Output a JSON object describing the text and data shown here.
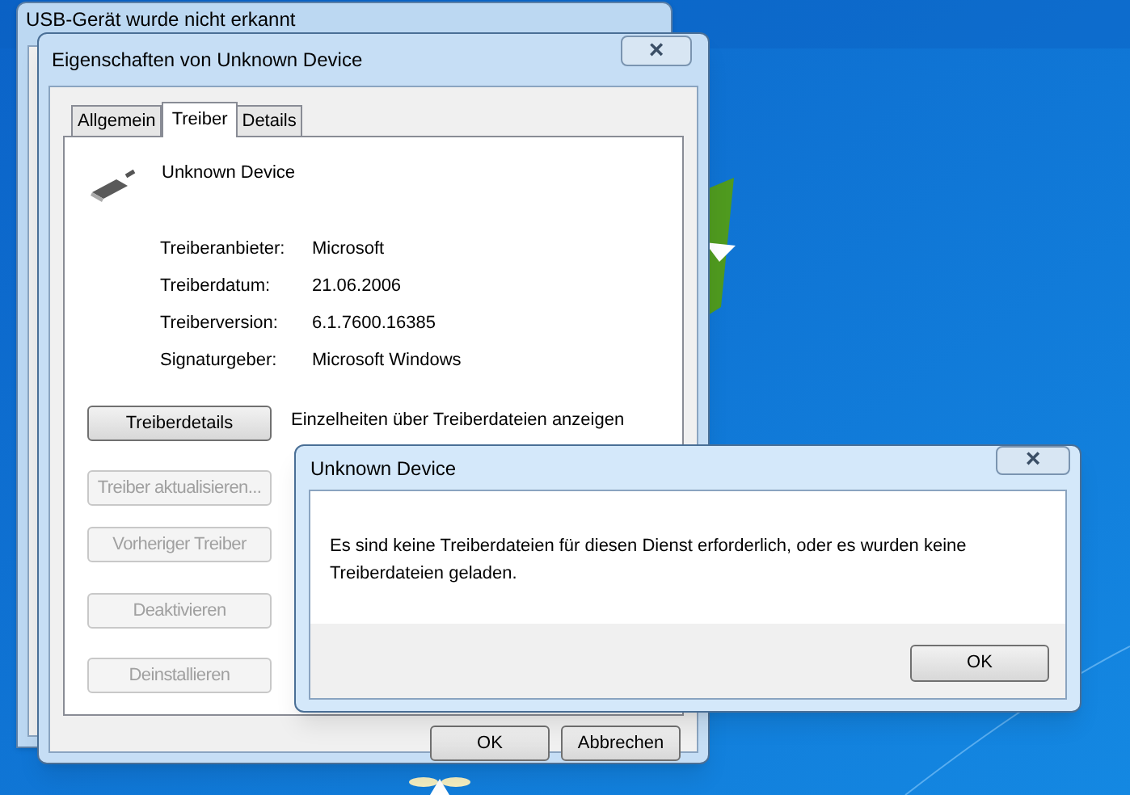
{
  "background_window": {
    "title": "USB-Gerät wurde nicht erkannt"
  },
  "properties_window": {
    "title": "Eigenschaften von Unknown Device",
    "close": "×",
    "tabs": [
      {
        "label": "Allgemein",
        "selected": false
      },
      {
        "label": "Treiber",
        "selected": true
      },
      {
        "label": "Details",
        "selected": false
      }
    ],
    "device_name": "Unknown Device",
    "fields": [
      {
        "label": "Treiberanbieter:",
        "value": "Microsoft"
      },
      {
        "label": "Treiberdatum:",
        "value": "21.06.2006"
      },
      {
        "label": "Treiberversion:",
        "value": "6.1.7600.16385"
      },
      {
        "label": "Signaturgeber:",
        "value": "Microsoft Windows"
      }
    ],
    "actions": [
      {
        "label": "Treiberdetails",
        "disabled": false,
        "description": [
          "Einzelheiten über Treiberdateien anzeigen"
        ]
      },
      {
        "label": "Treiber aktualisieren...",
        "disabled": true
      },
      {
        "label": "Vorheriger Treiber",
        "disabled": true
      },
      {
        "label": "Deaktivieren",
        "disabled": true
      },
      {
        "label": "Deinstallieren",
        "disabled": true
      }
    ],
    "buttons": [
      "OK",
      "Abbrechen"
    ]
  },
  "message_dialog": {
    "title": "Unknown Device",
    "close": "×",
    "message": "Es sind keine Treiberdateien für diesen Dienst erforderlich, oder es wurden keine Treiberdateien geladen.",
    "button": "OK"
  }
}
